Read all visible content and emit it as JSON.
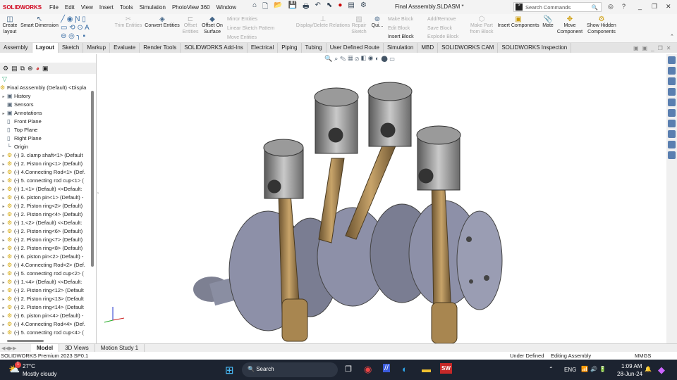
{
  "app": {
    "brand": "SOLIDWORKS",
    "title": "Final Asssembly.SLDASM *"
  },
  "menu": [
    "File",
    "Edit",
    "View",
    "Insert",
    "Tools",
    "Simulation",
    "PhotoView 360",
    "Window"
  ],
  "search": {
    "placeholder": "Search Commands"
  },
  "ribbon": {
    "create_layout": "Create layout",
    "smart_dimension": "Smart Dimension",
    "trim": "Trim Entities",
    "convert": "Convert Entities",
    "offset": "Offset Entities",
    "offset_surface": "Offset On Surface",
    "mirror": "Mirror Entities",
    "linear": "Linear Sketch Pattern",
    "move": "Move Entities",
    "display_delete": "Display/Delete Relations",
    "repair": "Repair Sketch",
    "quick": "Qui...",
    "make_block": "Make Block",
    "edit_block": "Edit Block",
    "insert_block": "Insert Block",
    "add_remove": "Add/Remove",
    "save_block": "Save Block",
    "explode_block": "Explode Block",
    "make_part": "Make Part from Block",
    "insert_components": "Insert Components",
    "mate": "Mate",
    "move_component": "Move Component",
    "show_hidden": "Show Hidden Components"
  },
  "tabs": [
    "Assembly",
    "Layout",
    "Sketch",
    "Markup",
    "Evaluate",
    "Render Tools",
    "SOLIDWORKS Add-Ins",
    "Electrical",
    "Piping",
    "Tubing",
    "User Defined Route",
    "Simulation",
    "MBD",
    "SOLIDWORKS CAM",
    "SOLIDWORKS Inspection"
  ],
  "active_tab": "Layout",
  "tree": {
    "root": "Final Asssembly (Default) <Displa",
    "items": [
      {
        "label": "History",
        "arrow": true,
        "icon": "folder"
      },
      {
        "label": "Sensors",
        "arrow": false,
        "icon": "folder"
      },
      {
        "label": "Annotations",
        "arrow": true,
        "icon": "folder"
      },
      {
        "label": "Front Plane",
        "arrow": false,
        "icon": "plane"
      },
      {
        "label": "Top Plane",
        "arrow": false,
        "icon": "plane"
      },
      {
        "label": "Right Plane",
        "arrow": false,
        "icon": "plane"
      },
      {
        "label": "Origin",
        "arrow": false,
        "icon": "origin"
      },
      {
        "label": "(-) 3. clamp shaft<1> (Default",
        "arrow": true,
        "icon": "part"
      },
      {
        "label": "(-) 2. Piston ring<1> (Default)",
        "arrow": true,
        "icon": "part"
      },
      {
        "label": "(-) 4.Connecting Rod<1> (Def.",
        "arrow": true,
        "icon": "part"
      },
      {
        "label": "(-) 5. connecting rod cup<1> (",
        "arrow": true,
        "icon": "part"
      },
      {
        "label": "(-) 1.<1> (Default) <<Default:",
        "arrow": true,
        "icon": "part"
      },
      {
        "label": "(-) 6. piston pin<1> (Default) -",
        "arrow": true,
        "icon": "part"
      },
      {
        "label": "(-) 2. Piston ring<2> (Default)",
        "arrow": true,
        "icon": "part"
      },
      {
        "label": "(-) 2. Piston ring<4> (Default)",
        "arrow": true,
        "icon": "part"
      },
      {
        "label": "(-) 1.<2> (Default) <<Default:",
        "arrow": true,
        "icon": "part"
      },
      {
        "label": "(-) 2. Piston ring<6> (Default)",
        "arrow": true,
        "icon": "part"
      },
      {
        "label": "(-) 2. Piston ring<7> (Default)",
        "arrow": true,
        "icon": "part"
      },
      {
        "label": "(-) 2. Piston ring<8> (Default)",
        "arrow": true,
        "icon": "part"
      },
      {
        "label": "(-) 6. piston pin<2> (Default) -",
        "arrow": true,
        "icon": "part"
      },
      {
        "label": "(-) 4.Connecting Rod<2> (Def.",
        "arrow": true,
        "icon": "part"
      },
      {
        "label": "(-) 5. connecting rod cup<2> (",
        "arrow": true,
        "icon": "part"
      },
      {
        "label": "(-) 1.<4> (Default) <<Default:",
        "arrow": true,
        "icon": "part"
      },
      {
        "label": "(-) 2. Piston ring<12> (Default",
        "arrow": true,
        "icon": "part"
      },
      {
        "label": "(-) 2. Piston ring<13> (Default",
        "arrow": true,
        "icon": "part"
      },
      {
        "label": "(-) 2. Piston ring<14> (Default",
        "arrow": true,
        "icon": "part"
      },
      {
        "label": "(-) 6. piston pin<4> (Default) -",
        "arrow": true,
        "icon": "part"
      },
      {
        "label": "(-) 4.Connecting Rod<4> (Def.",
        "arrow": true,
        "icon": "part"
      },
      {
        "label": "(-) 5. connecting rod cup<4> (",
        "arrow": true,
        "icon": "part"
      }
    ]
  },
  "bottom_tabs": [
    "Model",
    "3D Views",
    "Motion Study 1"
  ],
  "status": {
    "version": "SOLIDWORKS Premium 2023 SP0.1",
    "defined": "Under Defined",
    "mode": "Editing Assembly",
    "units": "MMGS"
  },
  "taskbar": {
    "temp": "27°C",
    "weather": "Mostly cloudy",
    "badge": "1",
    "search": "Search",
    "lang": "ENG",
    "time": "1:09 AM",
    "date": "28-Jun-24"
  }
}
